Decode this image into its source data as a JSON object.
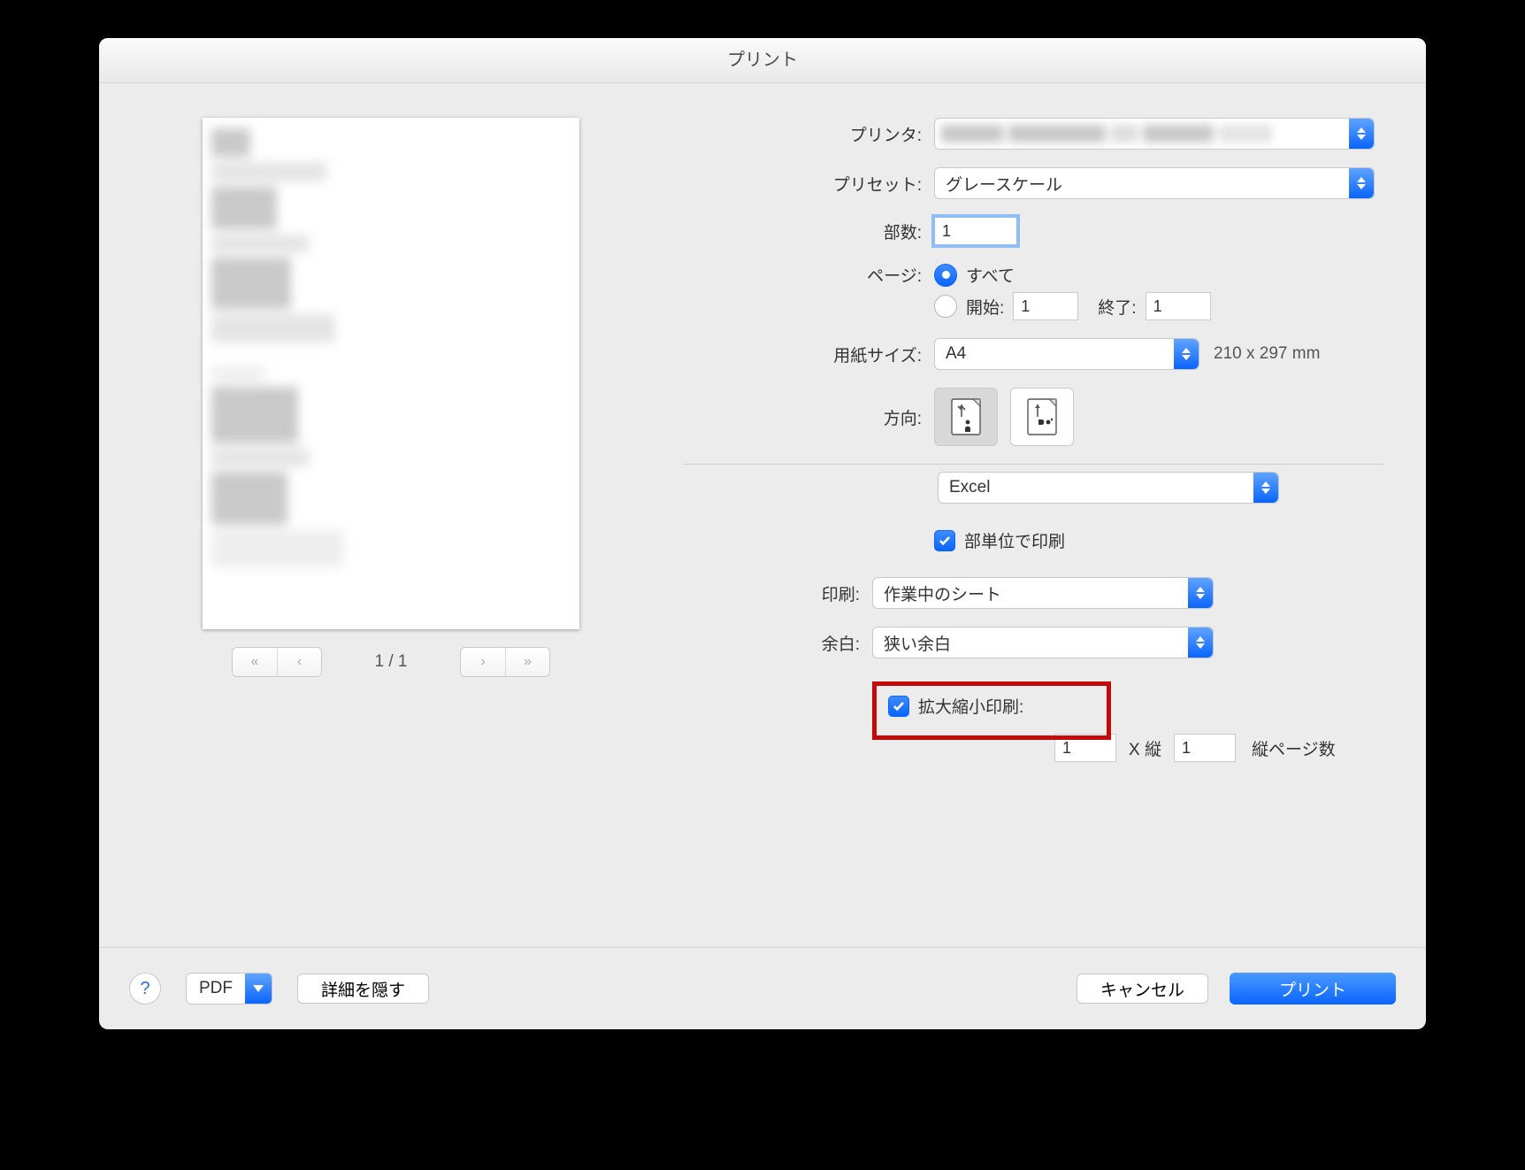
{
  "title": "プリント",
  "labels": {
    "printer": "プリンタ:",
    "preset": "プリセット:",
    "copies": "部数:",
    "pages": "ページ:",
    "pages_all": "すべて",
    "pages_from": "開始:",
    "pages_to": "終了:",
    "paper_size": "用紙サイズ:",
    "paper_dims": "210 x 297 mm",
    "orientation": "方向:",
    "app_section": "Excel",
    "collate": "部単位で印刷",
    "print": "印刷:",
    "margins": "余白:",
    "fit": "拡大縮小印刷:",
    "fit_x": "X 縦",
    "fit_pages_tall": "縦ページ数"
  },
  "values": {
    "printer": "",
    "preset": "グレースケール",
    "copies": "1",
    "pages_from": "1",
    "pages_to": "1",
    "paper_size": "A4",
    "print_what": "作業中のシート",
    "margins": "狭い余白",
    "fit_wide": "1",
    "fit_tall": "1"
  },
  "preview": {
    "page_indicator": "1 / 1"
  },
  "footer": {
    "pdf": "PDF",
    "hide_details": "詳細を隠す",
    "cancel": "キャンセル",
    "print": "プリント"
  }
}
